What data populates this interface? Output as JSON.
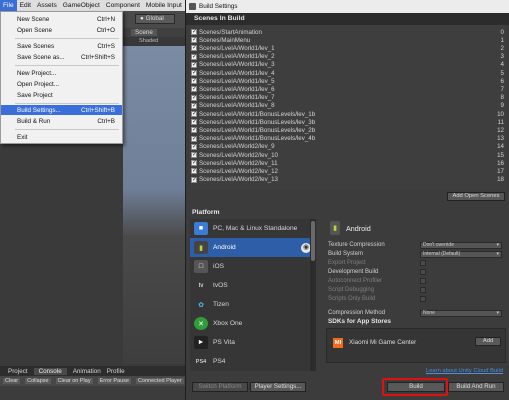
{
  "menubar": {
    "items": [
      "File",
      "Edit",
      "Assets",
      "GameObject",
      "Component",
      "Mobile Input"
    ]
  },
  "file_menu": {
    "items": [
      {
        "label": "New Scene",
        "shortcut": "Ctrl+N"
      },
      {
        "label": "Open Scene",
        "shortcut": "Ctrl+O"
      },
      {
        "label": "Save Scenes",
        "shortcut": "Ctrl+S"
      },
      {
        "label": "Save Scene as...",
        "shortcut": "Ctrl+Shift+S"
      },
      {
        "label": "New Project...",
        "shortcut": ""
      },
      {
        "label": "Open Project...",
        "shortcut": ""
      },
      {
        "label": "Save Project",
        "shortcut": ""
      },
      {
        "label": "Build Settings...",
        "shortcut": "Ctrl+Shift+B"
      },
      {
        "label": "Build & Run",
        "shortcut": "Ctrl+B"
      },
      {
        "label": "Exit",
        "shortcut": ""
      }
    ],
    "highlighted": "Build Settings..."
  },
  "background": {
    "global_label": "Global",
    "scene_tab": "Scene",
    "shaded_label": "Shaded",
    "bottom_tabs": [
      "Project",
      "Console",
      "Animation",
      "Profile"
    ],
    "console_buttons": [
      "Clear",
      "Collapse",
      "Clear on Play",
      "Error Pause",
      "Connected Player"
    ]
  },
  "window": {
    "title": "Build Settings",
    "scenes_header": "Scenes In Build",
    "scenes": [
      {
        "path": "Scenes/StartAnimation",
        "index": "0"
      },
      {
        "path": "Scenes/MainMenu",
        "index": "1"
      },
      {
        "path": "Scenes/LvelA/World1/lev_1",
        "index": "2"
      },
      {
        "path": "Scenes/LvelA/World1/lev_2",
        "index": "3"
      },
      {
        "path": "Scenes/LvelA/World1/lev_3",
        "index": "4"
      },
      {
        "path": "Scenes/LvelA/World1/lev_4",
        "index": "5"
      },
      {
        "path": "Scenes/LvelA/World1/lev_5",
        "index": "6"
      },
      {
        "path": "Scenes/LvelA/World1/lev_6",
        "index": "7"
      },
      {
        "path": "Scenes/LvelA/World1/lev_7",
        "index": "8"
      },
      {
        "path": "Scenes/LvelA/World1/lev_8",
        "index": "9"
      },
      {
        "path": "Scenes/LvelA/World1/BonusLevels/lev_1b",
        "index": "10"
      },
      {
        "path": "Scenes/LvelA/World1/BonusLevels/lev_3b",
        "index": "11"
      },
      {
        "path": "Scenes/LvelA/World1/BonusLevels/lev_2b",
        "index": "12"
      },
      {
        "path": "Scenes/LvelA/World1/BonusLevels/lev_4b",
        "index": "13"
      },
      {
        "path": "Scenes/LvelA/World2/lev_9",
        "index": "14"
      },
      {
        "path": "Scenes/LvelA/World2/lev_10",
        "index": "15"
      },
      {
        "path": "Scenes/LvelA/World2/lev_11",
        "index": "16"
      },
      {
        "path": "Scenes/LvelA/World2/lev_12",
        "index": "17"
      },
      {
        "path": "Scenes/LvelA/World2/lev_13",
        "index": "18"
      }
    ],
    "add_open_scenes": "Add Open Scenes",
    "platform_header": "Platform",
    "platforms": [
      {
        "name": "PC, Mac & Linux Standalone",
        "icon": "pc-icon"
      },
      {
        "name": "Android",
        "icon": "android-icon"
      },
      {
        "name": "iOS",
        "icon": "ios-icon"
      },
      {
        "name": "tvOS",
        "icon": "tvos-icon"
      },
      {
        "name": "Tizen",
        "icon": "tizen-icon"
      },
      {
        "name": "Xbox One",
        "icon": "xbox-icon"
      },
      {
        "name": "PS Vita",
        "icon": "psvita-icon"
      },
      {
        "name": "PS4",
        "icon": "ps4-icon"
      }
    ],
    "selected_platform": "Android",
    "settings": {
      "title": "Android",
      "texture_compression_label": "Texture Compression",
      "texture_compression_value": "Don't override",
      "build_system_label": "Build System",
      "build_system_value": "Internal (Default)",
      "export_project": "Export Project",
      "development_build": "Development Build",
      "autoconnect_profiler": "Autoconnect Profiler",
      "script_debugging": "Script Debugging",
      "scripts_only_build": "Scripts Only Build",
      "compression_method_label": "Compression Method",
      "compression_method_value": "None"
    },
    "sdk_header": "SDKs for App Stores",
    "sdk_item": "Xiaomi Mi Game Center",
    "sdk_add": "Add",
    "cloud_link": "Learn about Unity Cloud Build",
    "switch_platform": "Switch Platform",
    "player_settings": "Player Settings...",
    "build": "Build",
    "build_and_run": "Build And Run"
  }
}
